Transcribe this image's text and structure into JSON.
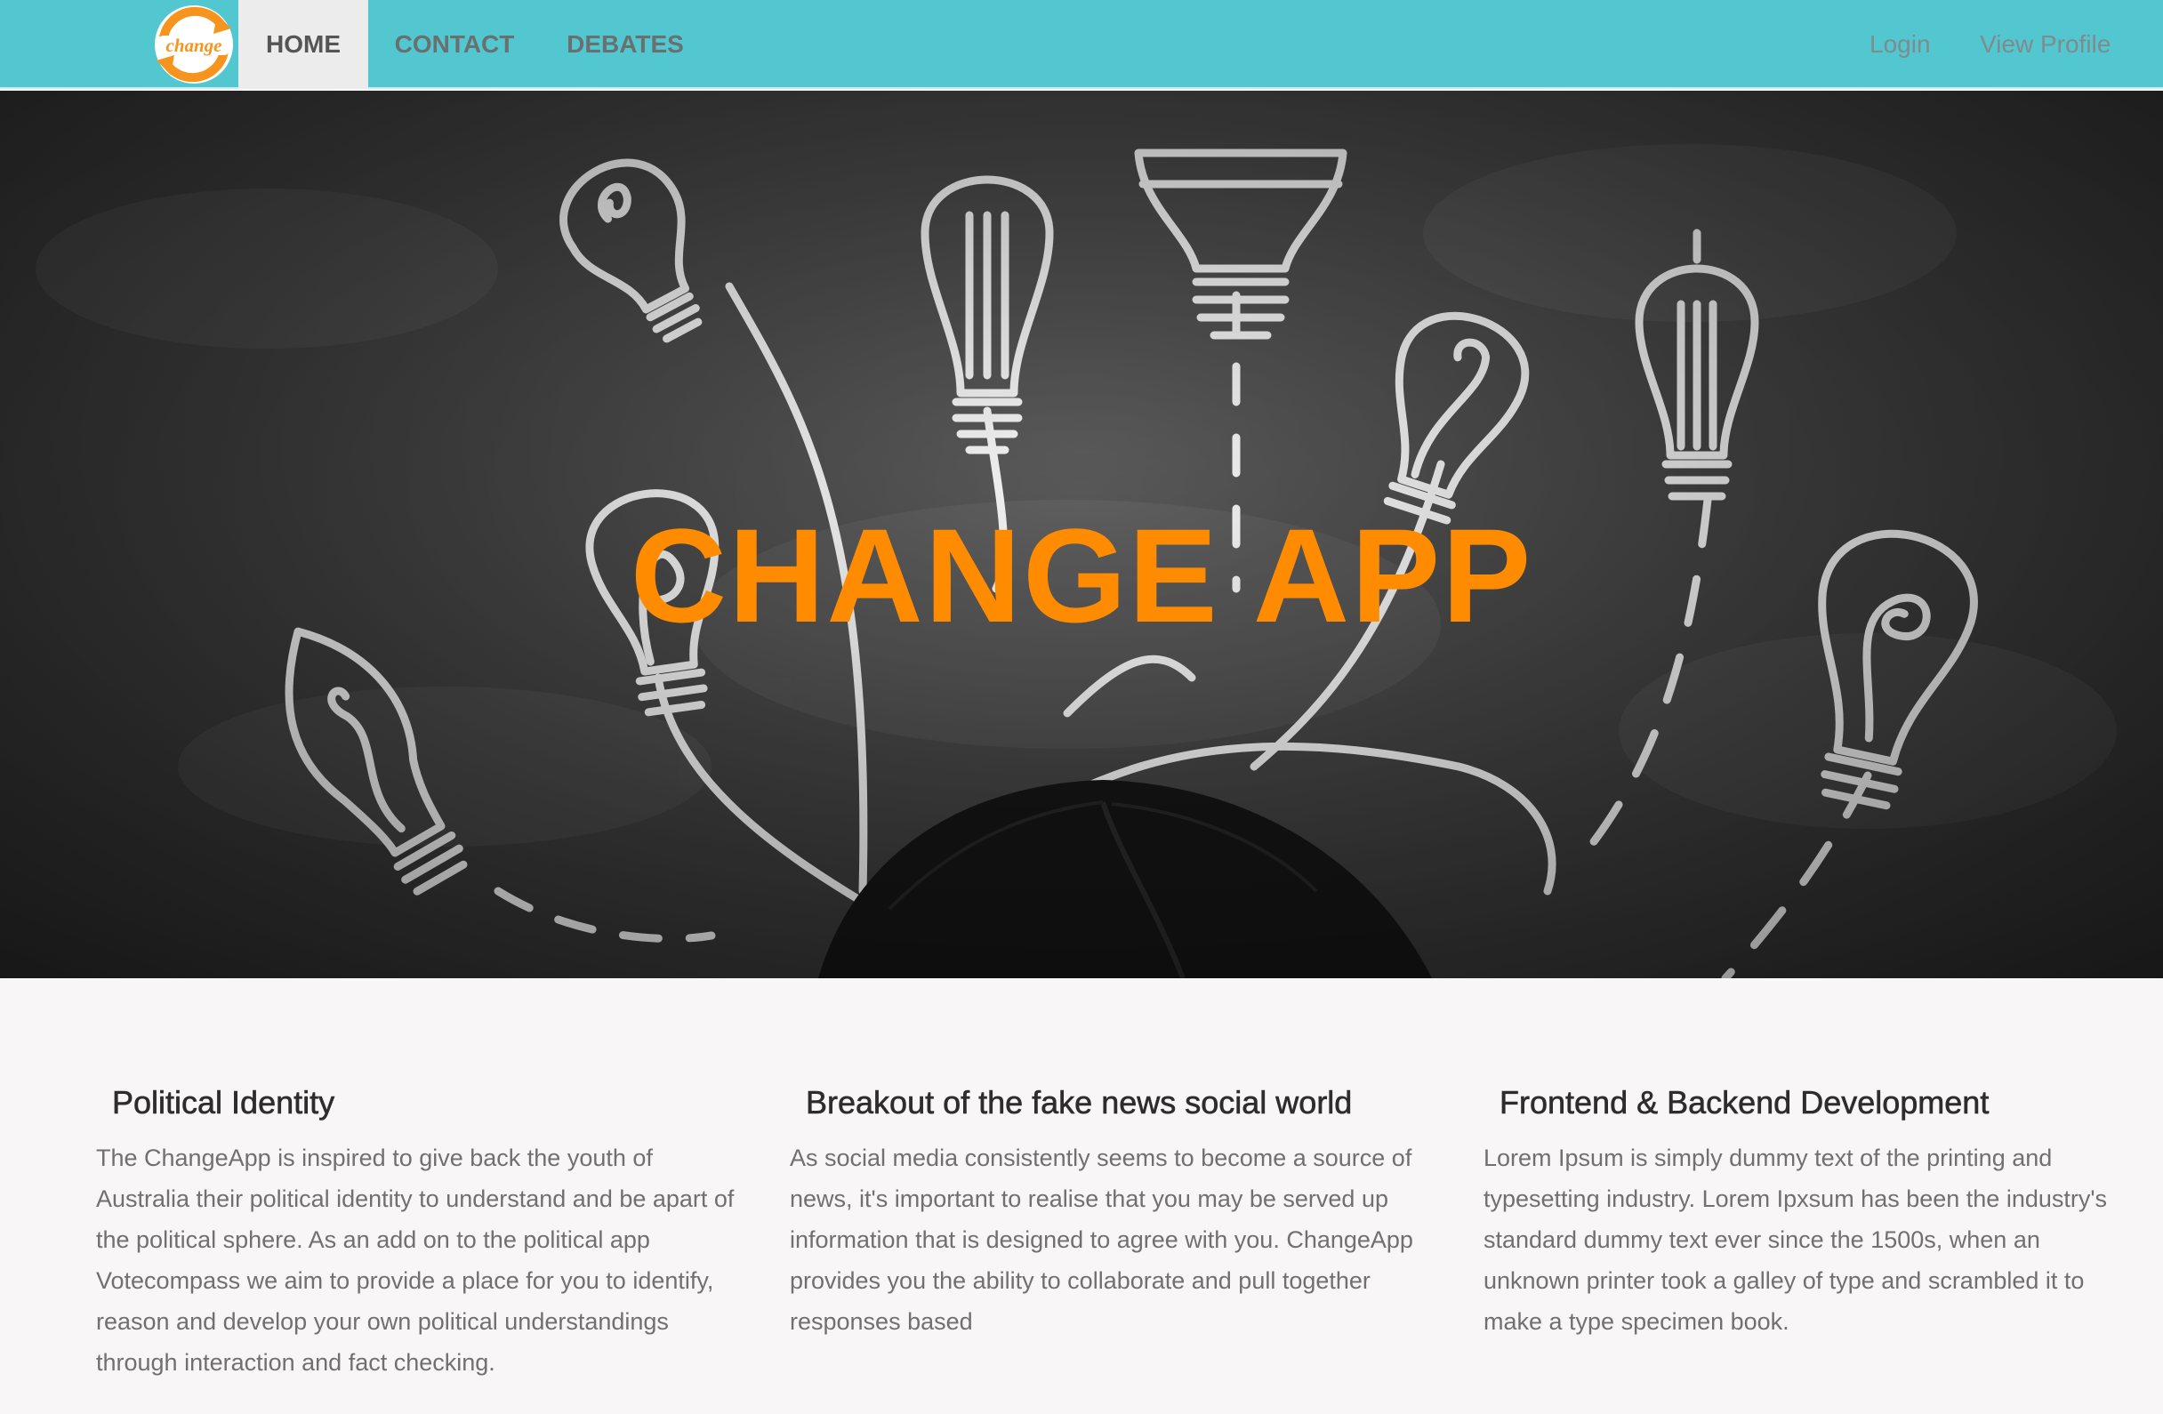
{
  "nav": {
    "logo_text": "change",
    "links": [
      {
        "label": "HOME",
        "active": true
      },
      {
        "label": "CONTACT",
        "active": false
      },
      {
        "label": "DEBATES",
        "active": false
      }
    ],
    "login_label": "Login",
    "profile_label": "View Profile"
  },
  "hero": {
    "title": "CHANGE APP"
  },
  "features": [
    {
      "title": "Political Identity",
      "body": "The ChangeApp is inspired to give back the youth of Australia their political identity to understand and be apart of the political sphere. As an add on to the political app Votecompass we aim to provide a place for you to identify, reason and develop your own political understandings through interaction and fact checking."
    },
    {
      "title": "Breakout of the fake news social world",
      "body": "As social media consistently seems to become a source of news, it's important to realise that you may be served up information that is designed to agree with you. ChangeApp provides you the ability to collaborate and pull together responses based"
    },
    {
      "title": "Frontend & Backend Development",
      "body": "Lorem Ipsum is simply dummy text of the printing and typesetting industry. Lorem Ipxsum has been the industry's standard dummy text ever since the 1500s, when an unknown printer took a galley of type and scrambled it to make a type specimen book."
    }
  ],
  "colors": {
    "navbar": "#52c7cf",
    "accent": "#ff8c00",
    "active_tab": "#ececec",
    "page_bg": "#f8f6f6"
  }
}
